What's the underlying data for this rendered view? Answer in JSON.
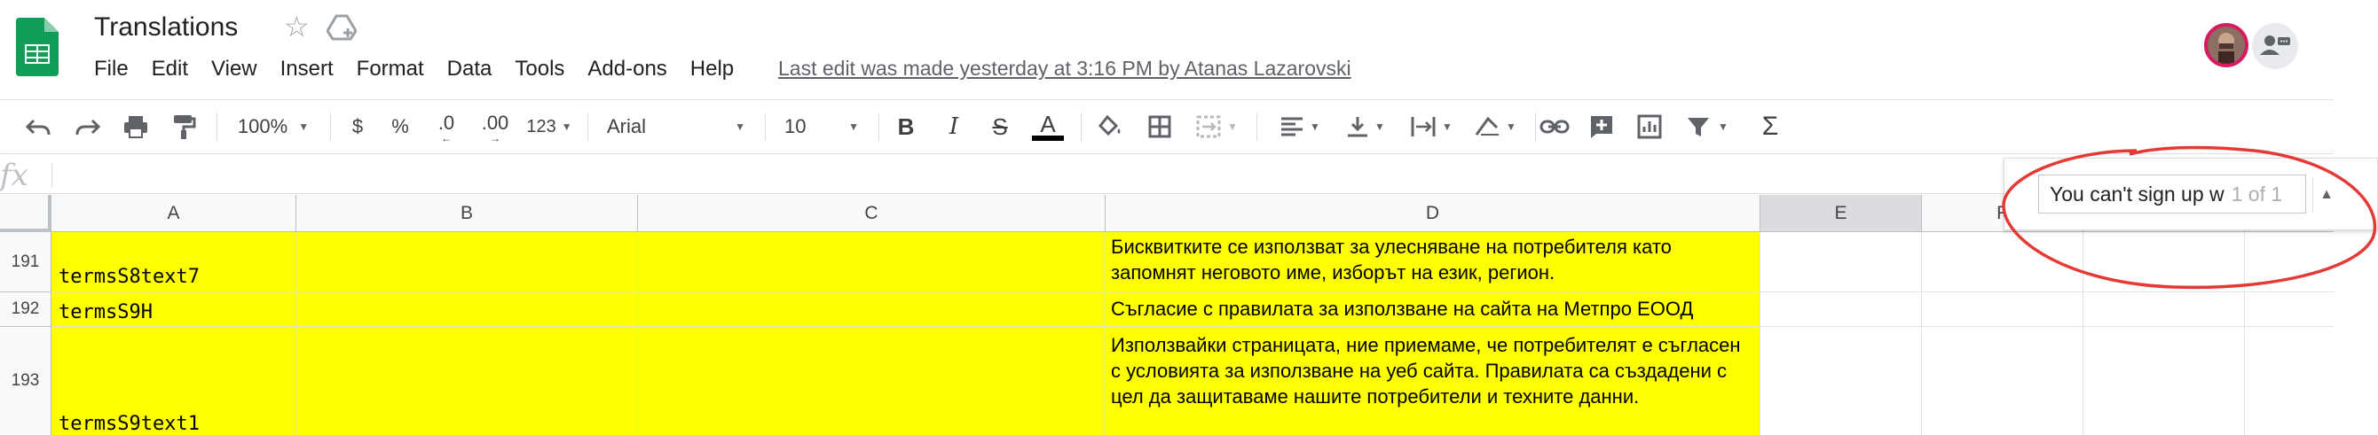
{
  "app": {
    "title": "Translations",
    "menu": [
      "File",
      "Edit",
      "View",
      "Insert",
      "Format",
      "Data",
      "Tools",
      "Add-ons",
      "Help"
    ],
    "last_edit": "Last edit was made yesterday at 3:16 PM by Atanas Lazarovski"
  },
  "toolbar": {
    "zoom": "100%",
    "currency": "$",
    "percent": "%",
    "decimal_decrease": ".0",
    "decimal_increase": ".00",
    "more_formats": "123",
    "font": "Arial",
    "font_size": "10",
    "bold": "B",
    "italic": "I",
    "strikethrough": "S",
    "text_color_letter": "A",
    "sigma": "Σ"
  },
  "formula_bar": {
    "fx": "fx",
    "value": ""
  },
  "columns": [
    "A",
    "B",
    "C",
    "D",
    "E",
    "F"
  ],
  "rows": [
    {
      "num": "191",
      "a": "termsS8text7",
      "d": "Бисквитките се използват за улесняване на потребителя като запомнят неговото име, изборът на език, регион."
    },
    {
      "num": "192",
      "a": "termsS9H",
      "d": "Съгласие с правилата за използване на сайта на Метпро ЕООД"
    },
    {
      "num": "193",
      "a": "termsS9text1",
      "d": "Използвайки страницата, ние приемаме, че потребителят е съгласен с условията за използване на уеб сайта. Правилата са създадени с цел да защитаваме нашите потребители и техните данни."
    }
  ],
  "find": {
    "query": "You can't sign up w",
    "count": "1 of 1"
  },
  "colors": {
    "highlight": "#ffff00",
    "annotation": "#e53935",
    "sheets_green": "#0f9d58"
  }
}
